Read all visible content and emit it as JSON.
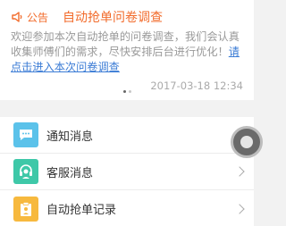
{
  "notice": {
    "tag": "公告",
    "title": "自动抢单问卷调查",
    "body": "欢迎参加本次自动抢单的问卷调查，我们会认真收集师傅们的需求，尽快安排后台进行优化！",
    "link": "请点击进入本次问卷调查",
    "date": "2017-03-18 12:34",
    "icon": "speaker-icon"
  },
  "menu": {
    "items": [
      {
        "label": "通知消息",
        "icon": "chat-bubble-icon",
        "color": "#5bc2ea"
      },
      {
        "label": "客服消息",
        "icon": "headset-icon",
        "color": "#3ec8a8"
      },
      {
        "label": "自动抢单记录",
        "icon": "clipboard-icon",
        "color": "#f7b93e"
      }
    ]
  },
  "colors": {
    "accent": "#f26b2b",
    "link": "#3a7bd5"
  }
}
